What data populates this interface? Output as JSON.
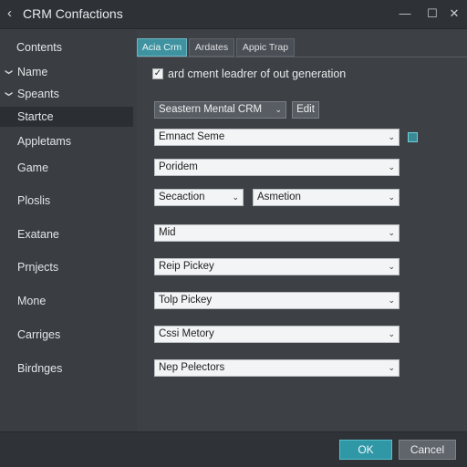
{
  "window": {
    "title": "CRM Confactions",
    "back_glyph": "‹",
    "minimize_glyph": "—",
    "maximize_glyph": "☐",
    "close_glyph": "✕"
  },
  "sidebar": {
    "header": "Contents",
    "items": [
      {
        "label": "Name",
        "expanded": true
      },
      {
        "label": "Speants",
        "expanded": true
      },
      {
        "label": "Startce",
        "selected": true
      },
      {
        "label": "Appletams"
      },
      {
        "label": "Game"
      },
      {
        "label": "Ploslis"
      },
      {
        "label": "Exatane"
      },
      {
        "label": "Prnjects"
      },
      {
        "label": "Mone"
      },
      {
        "label": "Carriges"
      },
      {
        "label": "Birdnges"
      }
    ]
  },
  "tabs": [
    {
      "label": "Acia Crm",
      "active": true
    },
    {
      "label": "Ardates"
    },
    {
      "label": "Appic Trap"
    }
  ],
  "options": {
    "checkbox_label": "ard cment leadrer of out generation",
    "checkbox_checked": true,
    "checkbox_glyph": "✓"
  },
  "fields": {
    "crm_select": "Seastern Mental CRM",
    "edit_button": "Edit",
    "contact_scheme": "Emnact Seme",
    "period": "Poridem",
    "section": "Secaction",
    "animation": "Asmetion",
    "mid": "Mid",
    "reip_pickey": "Reip Pickey",
    "tolp_pickey": "Tolp Pickey",
    "cost_memory": "Cssi Metory",
    "nep_pelectors": "Nep Pelectors",
    "caret_glyph": "⌄"
  },
  "footer": {
    "ok_label": "OK",
    "cancel_label": "Cancel"
  },
  "colors": {
    "accent": "#2f97a5",
    "background": "#3d4146",
    "titlebar": "#2e3236"
  }
}
